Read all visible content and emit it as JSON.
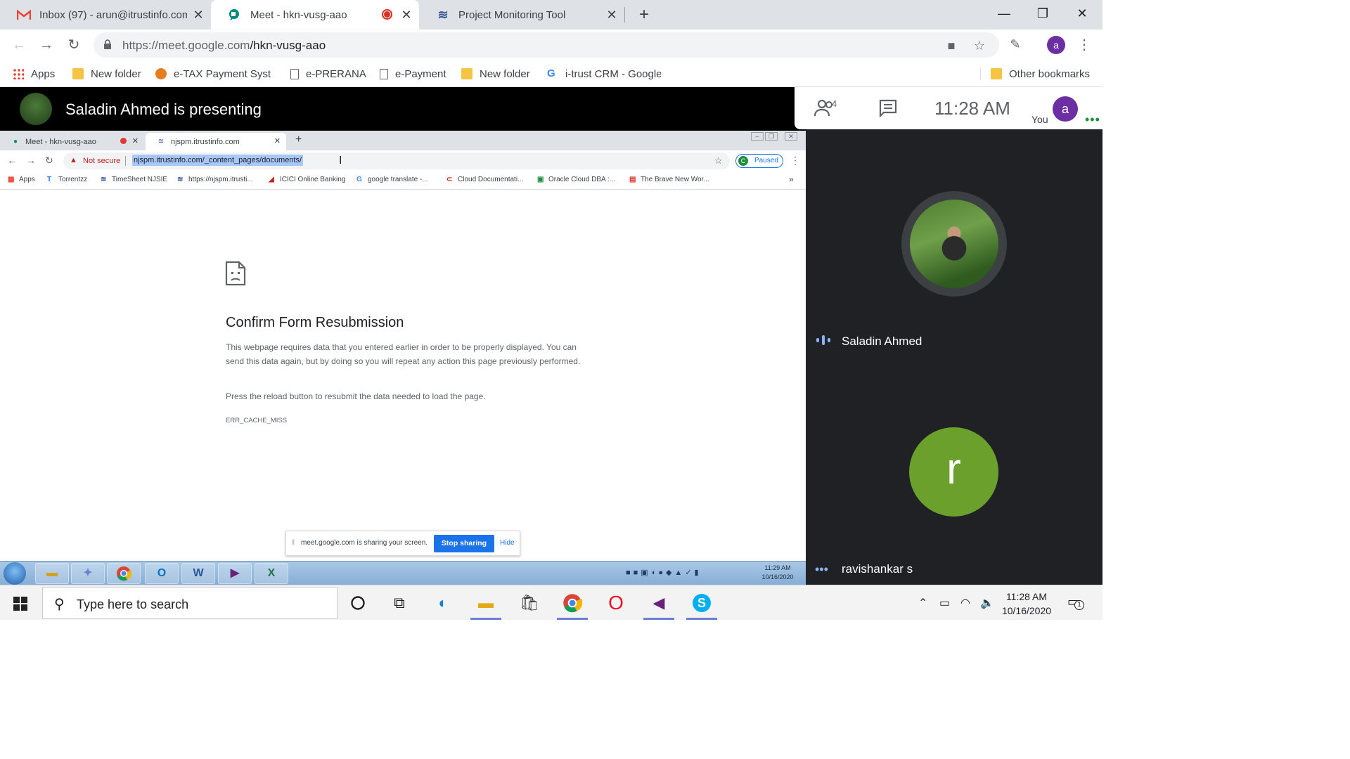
{
  "browser": {
    "tabs": [
      {
        "title": "Inbox (97) - arun@itrustinfo.com",
        "icon": "gmail-icon"
      },
      {
        "title": "Meet - hkn-vusg-aao",
        "icon": "meet-icon",
        "recording": true
      },
      {
        "title": "Project Monitoring Tool",
        "icon": "project-tool-icon"
      }
    ],
    "url_host": "https://meet.google.com",
    "url_path": "/hkn-vusg-aao",
    "profile_initial": "a",
    "bookmarks": [
      {
        "label": "Apps",
        "icon": "apps-icon"
      },
      {
        "label": "New folder",
        "icon": "folder-icon"
      },
      {
        "label": "e-TAX Payment Syste",
        "icon": "etax-icon"
      },
      {
        "label": "e-PRERANA",
        "icon": "page-icon"
      },
      {
        "label": "e-Payment",
        "icon": "page-icon"
      },
      {
        "label": "New folder",
        "icon": "folder-icon"
      },
      {
        "label": "i-trust CRM - Google",
        "icon": "google-icon"
      }
    ],
    "other_bookmarks": "Other bookmarks"
  },
  "meet": {
    "presenting_text": "Saladin Ahmed is presenting",
    "participant_count": "4",
    "clock": "11:28  AM",
    "you_label": "You",
    "you_initial": "a",
    "participants": [
      {
        "name": "Saladin Ahmed"
      },
      {
        "name": "ravishankar s",
        "initial": "r"
      }
    ]
  },
  "shared_screen": {
    "tabs": [
      {
        "title": "Meet - hkn-vusg-aao"
      },
      {
        "title": "njspm.itrustinfo.com"
      }
    ],
    "not_secure": "Not secure",
    "url": "njspm.itrustinfo.com/_content_pages/documents/",
    "paused_label": "Paused",
    "paused_initial": "C",
    "bookmarks": [
      {
        "label": "Apps",
        "icon": "▦"
      },
      {
        "label": "Torrentzz",
        "icon": "T"
      },
      {
        "label": "TimeSheet NJSIE",
        "icon": "≋"
      },
      {
        "label": "https://njspm.itrusti...",
        "icon": "≋"
      },
      {
        "label": "ICICI Online Banking",
        "icon": "◢"
      },
      {
        "label": "google translate -...",
        "icon": "G"
      },
      {
        "label": "Cloud Documentati...",
        "icon": "⊂"
      },
      {
        "label": "Oracle Cloud DBA :...",
        "icon": "▣"
      },
      {
        "label": "The Brave New Wor...",
        "icon": "▤"
      }
    ],
    "error": {
      "title": "Confirm Form Resubmission",
      "body": "This webpage requires data that you entered earlier in order to be properly displayed. You can send this data again, but by doing so you will repeat any action this page previously performed.",
      "body2": "Press the reload button to resubmit the data needed to load the page.",
      "code": "ERR_CACHE_MISS"
    },
    "share_bar": {
      "text": "meet.google.com is sharing your screen.",
      "stop": "Stop sharing",
      "hide": "Hide"
    },
    "clock_time": "11:29 AM",
    "clock_date": "10/16/2020"
  },
  "taskbar": {
    "search_placeholder": "Type here to search",
    "time": "11:28 AM",
    "date": "10/16/2020",
    "notification_count": "1"
  }
}
